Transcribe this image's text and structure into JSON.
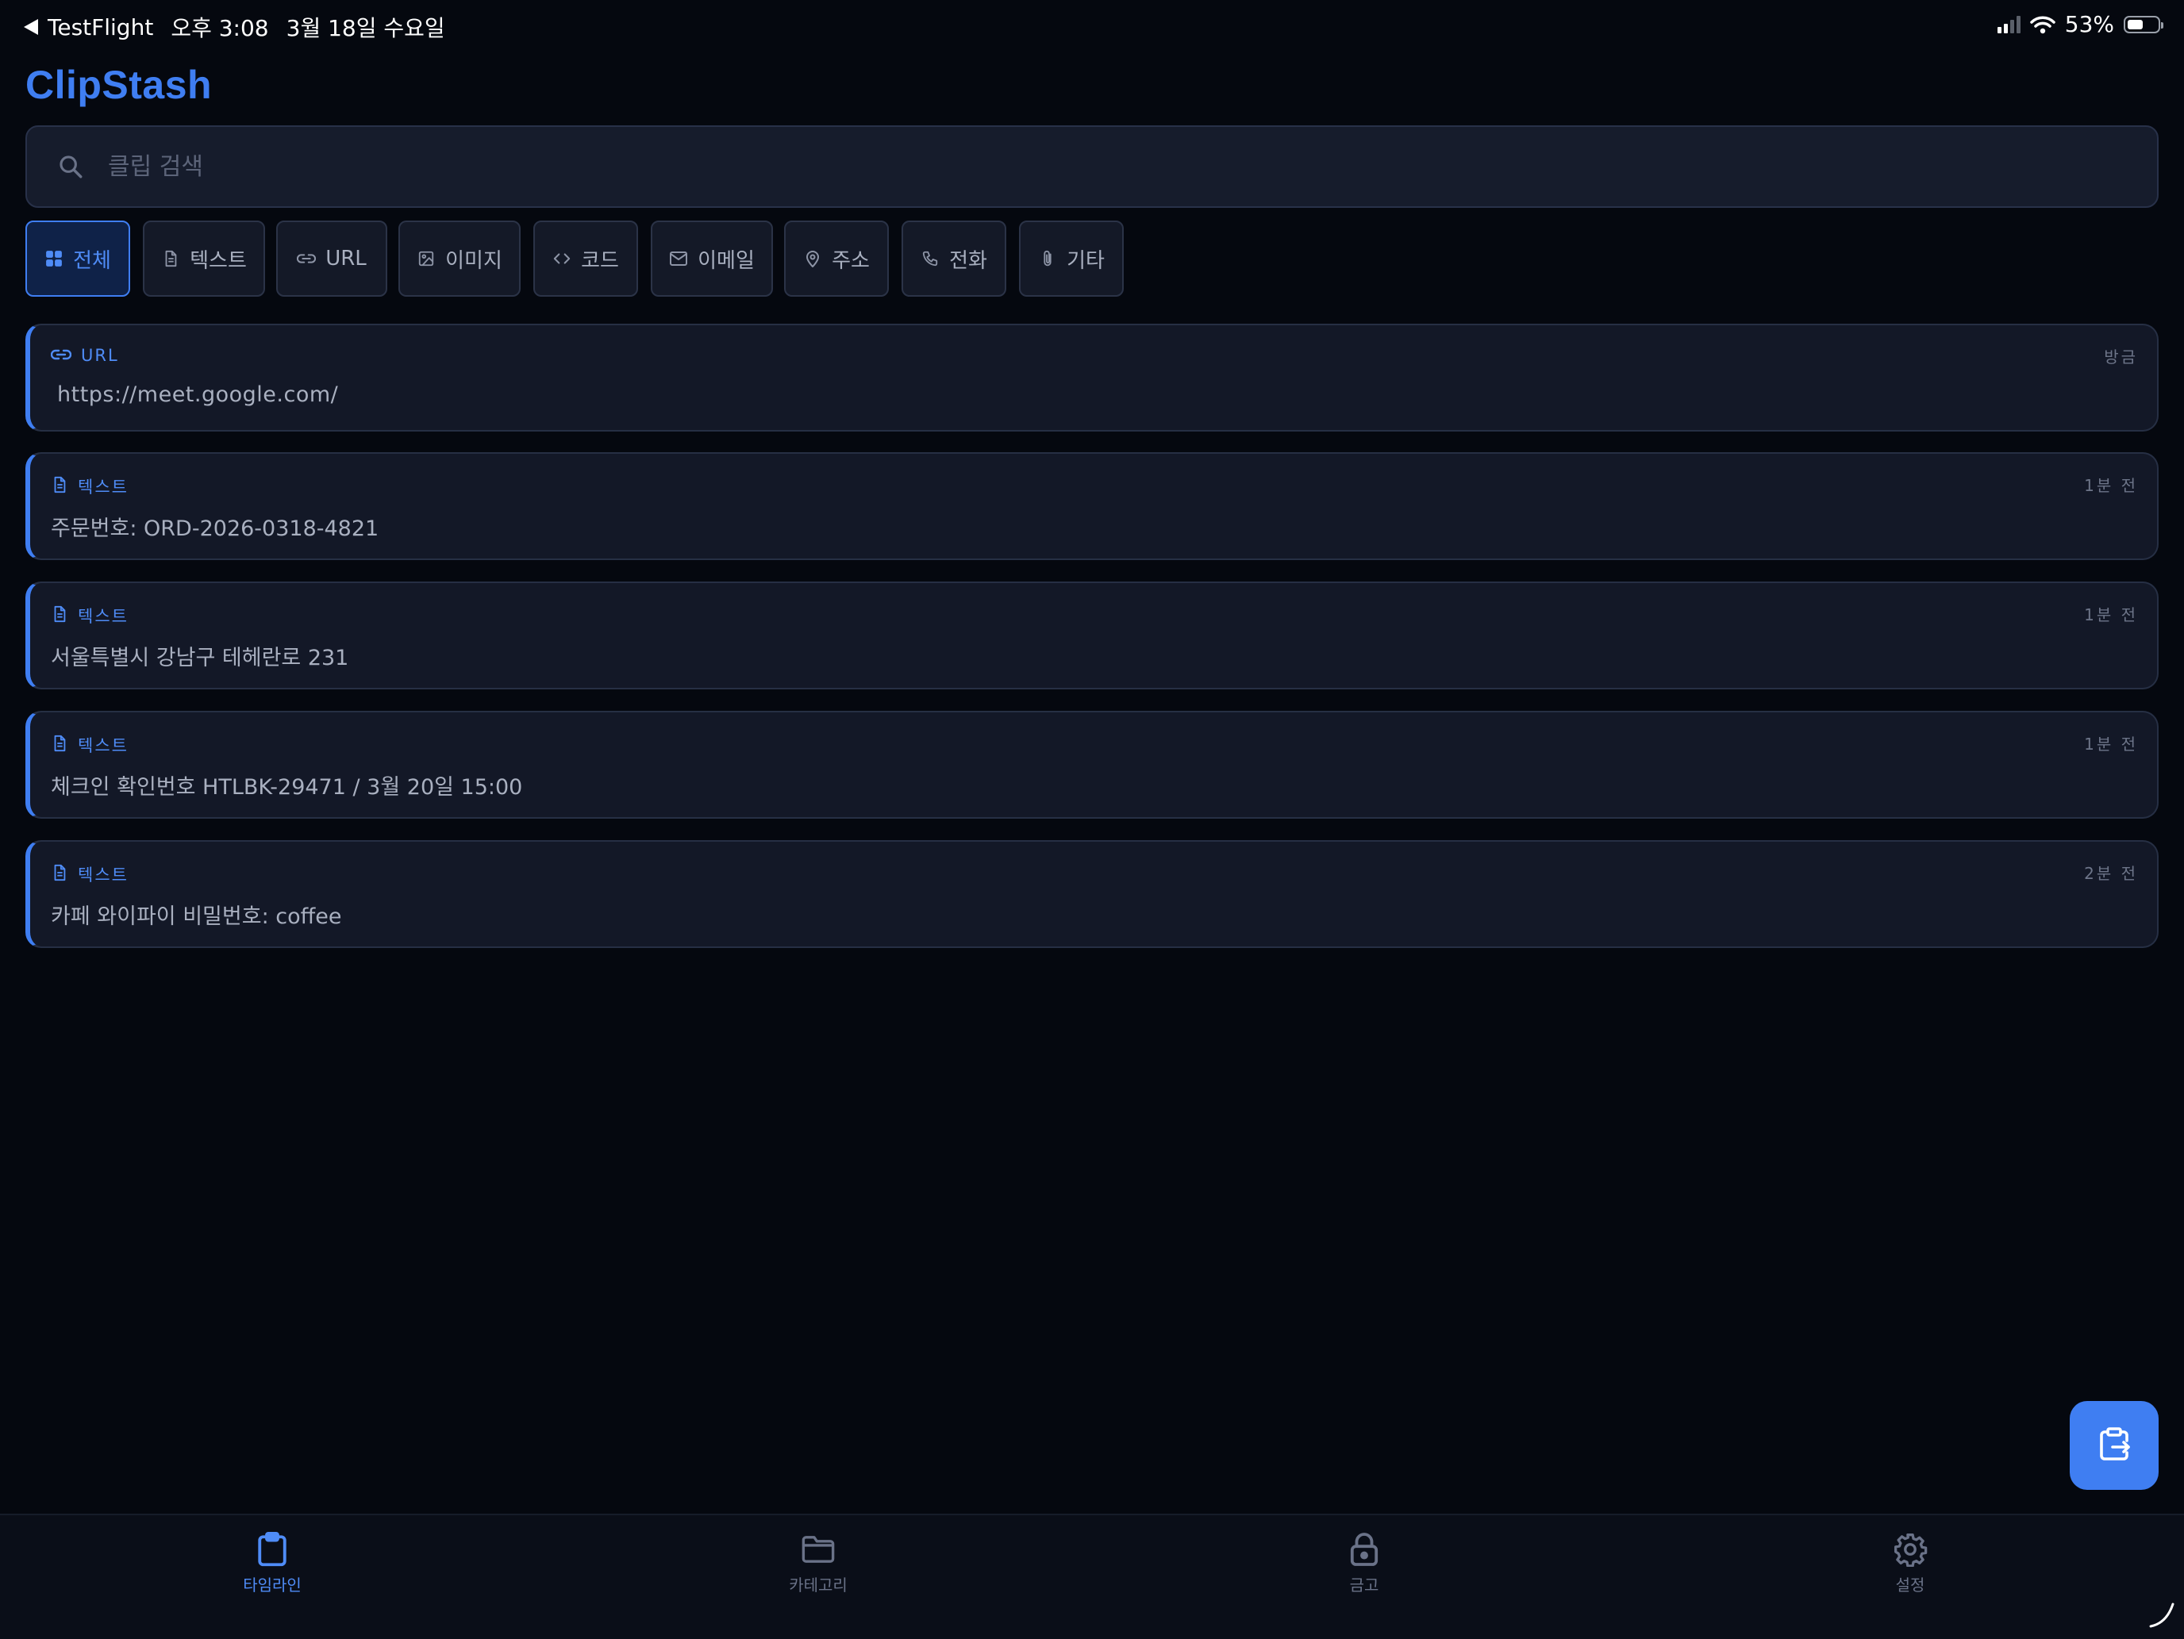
{
  "status_bar": {
    "back_app": "TestFlight",
    "time": "오후 3:08",
    "date": "3월 18일 수요일",
    "battery": "53%",
    "battery_level": 0.53
  },
  "app": {
    "title": "ClipStash",
    "accent_color": "#3f7ef2"
  },
  "search": {
    "placeholder": "클립 검색",
    "value": ""
  },
  "filters": [
    {
      "label": "전체",
      "icon": "grid-icon",
      "active": true
    },
    {
      "label": "텍스트",
      "icon": "document-icon",
      "active": false
    },
    {
      "label": "URL",
      "icon": "link-icon",
      "active": false
    },
    {
      "label": "이미지",
      "icon": "image-icon",
      "active": false
    },
    {
      "label": "코드",
      "icon": "code-icon",
      "active": false
    },
    {
      "label": "이메일",
      "icon": "mail-icon",
      "active": false
    },
    {
      "label": "주소",
      "icon": "map-pin-icon",
      "active": false
    },
    {
      "label": "전화",
      "icon": "phone-icon",
      "active": false
    },
    {
      "label": "기타",
      "icon": "paperclip-icon",
      "active": false
    }
  ],
  "clips": [
    {
      "type": "URL",
      "icon": "link-icon",
      "time": "방금",
      "content": "https://meet.google.com/"
    },
    {
      "type": "텍스트",
      "icon": "document-icon",
      "time": "1분 전",
      "content": "주문번호: ORD-2026-0318-4821"
    },
    {
      "type": "텍스트",
      "icon": "document-icon",
      "time": "1분 전",
      "content": "서울특별시 강남구 테헤란로 231"
    },
    {
      "type": "텍스트",
      "icon": "document-icon",
      "time": "1분 전",
      "content": "체크인 확인번호 HTLBK-29471 / 3월 20일 15:00"
    },
    {
      "type": "텍스트",
      "icon": "document-icon",
      "time": "2분 전",
      "content": "카페 와이파이 비밀번호: coffee"
    }
  ],
  "fab": {
    "icon": "clipboard-paste-icon"
  },
  "tabs": [
    {
      "label": "타임라인",
      "icon": "clipboard-icon",
      "active": true
    },
    {
      "label": "카테고리",
      "icon": "folder-icon",
      "active": false
    },
    {
      "label": "금고",
      "icon": "lock-icon",
      "active": false
    },
    {
      "label": "설정",
      "icon": "gear-icon",
      "active": false
    }
  ]
}
